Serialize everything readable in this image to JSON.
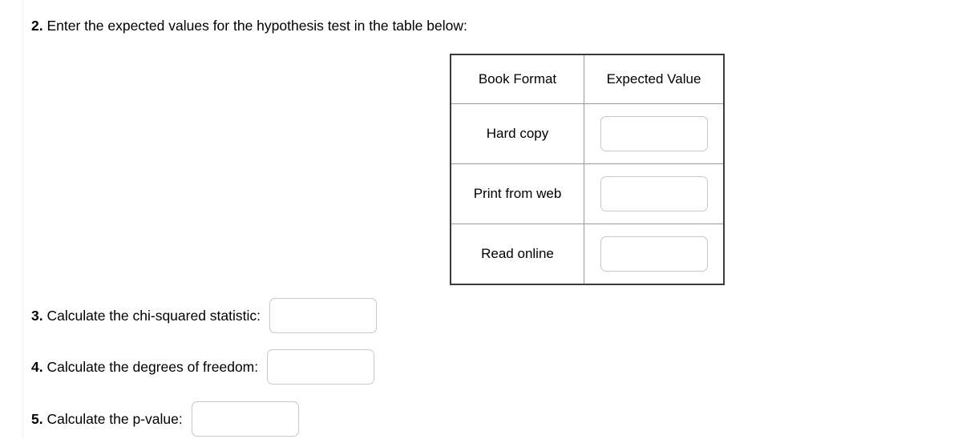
{
  "worksheet": {
    "question2": {
      "number": "2.",
      "text": "Enter the expected values for the hypothesis test in the table below:"
    },
    "table": {
      "headers": [
        "Book Format",
        "Expected Value"
      ],
      "rows": [
        {
          "format": "Hard copy",
          "expected_value": ""
        },
        {
          "format": "Print from web",
          "expected_value": ""
        },
        {
          "format": "Read online",
          "expected_value": ""
        }
      ]
    },
    "questions": [
      {
        "number": "3.",
        "text": "Calculate the chi-squared statistic:",
        "answer": ""
      },
      {
        "number": "4.",
        "text": "Calculate the degrees of freedom:",
        "answer": ""
      },
      {
        "number": "5.",
        "text": "Calculate the p-value:",
        "answer": ""
      }
    ]
  },
  "colors": {
    "text": "#000000",
    "table_outer_border": "#3b3b3b",
    "table_inner_border": "#9a9a9a",
    "input_border": "#c9c9cb",
    "margin_rule": "#f4f4f6",
    "background": "#ffffff"
  }
}
